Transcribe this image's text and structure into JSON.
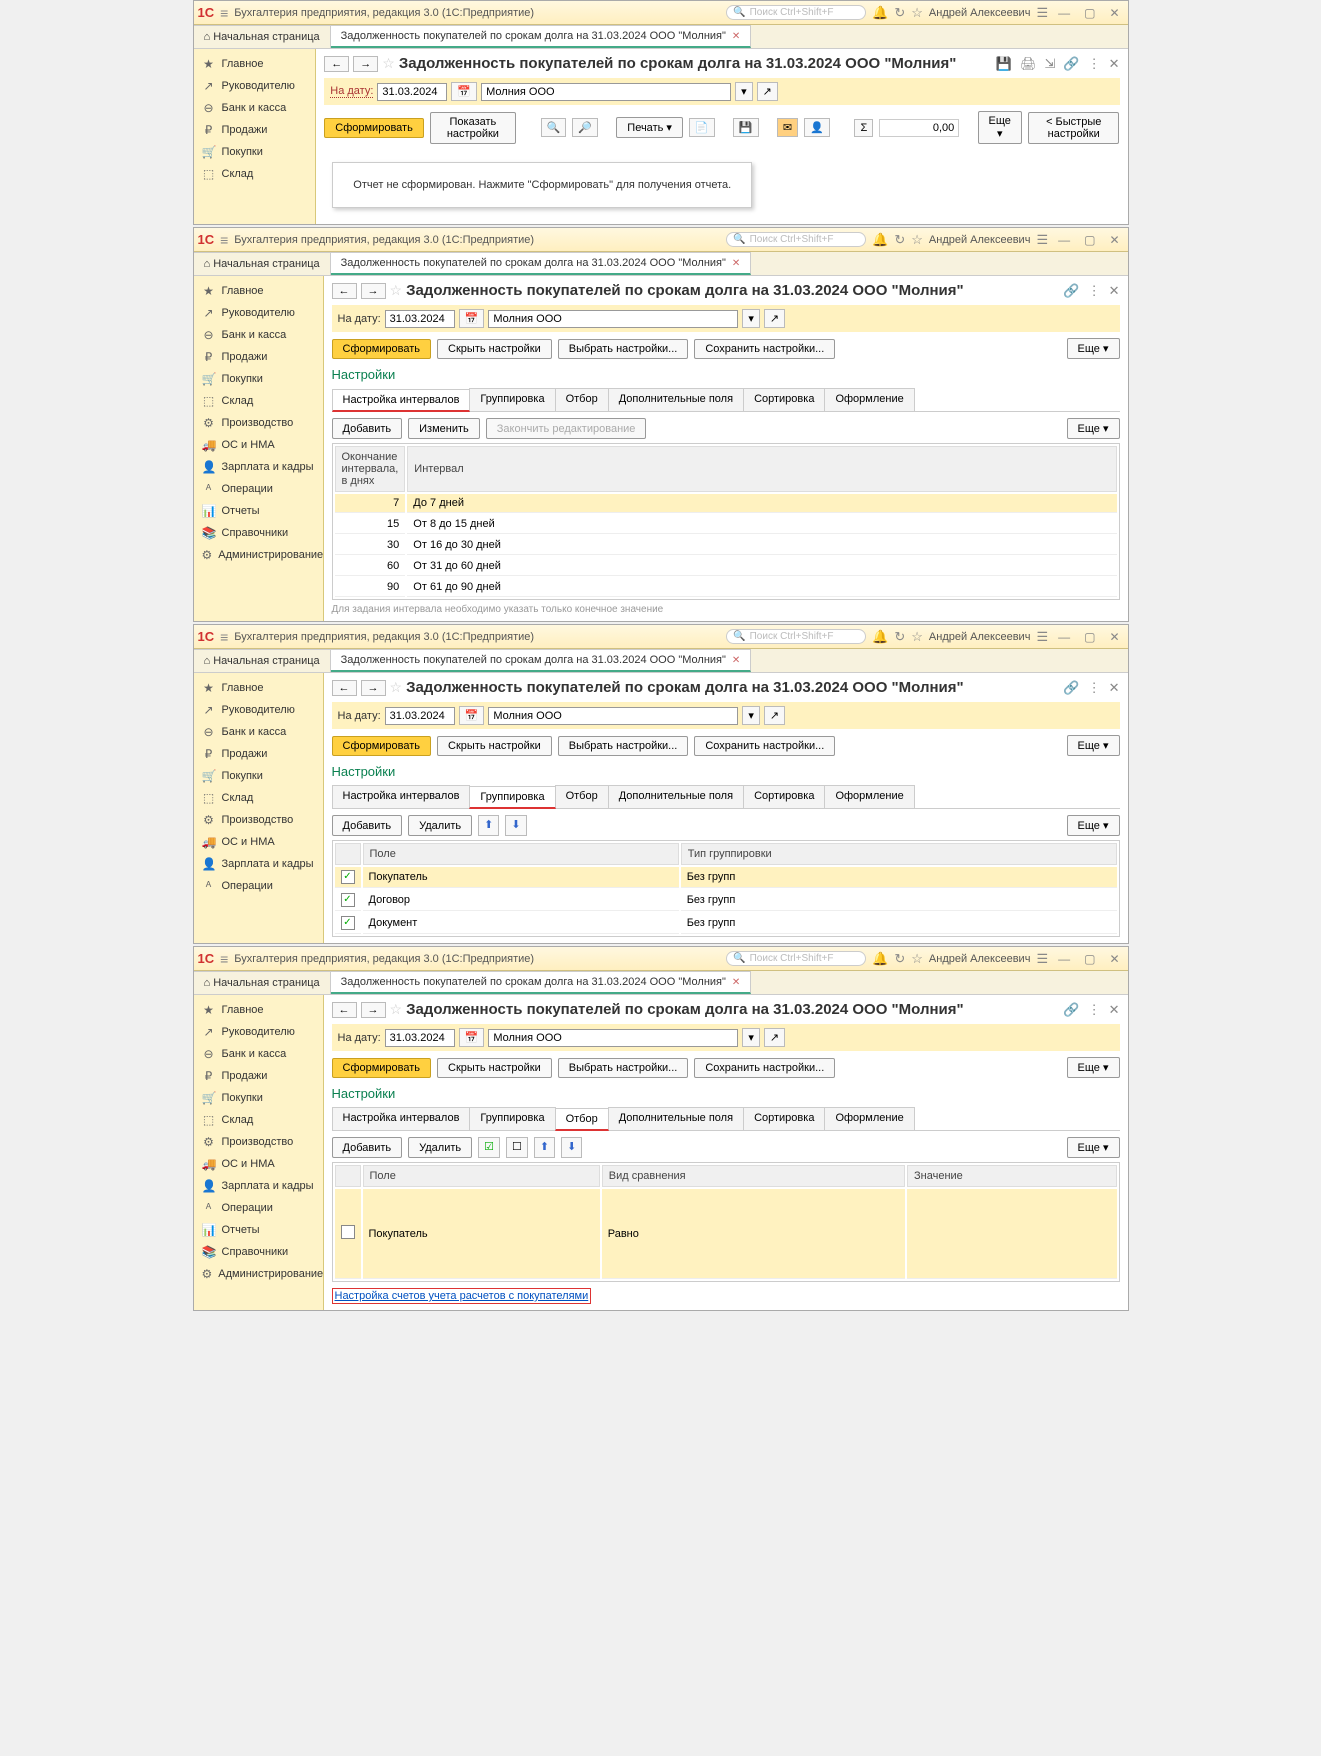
{
  "app_title": "Бухгалтерия предприятия, редакция 3.0  (1С:Предприятие)",
  "search_placeholder": "Поиск Ctrl+Shift+F",
  "user": "Андрей Алексеевич",
  "tab_home": "Начальная страница",
  "tab_report": "Задолженность покупателей по срокам долга на 31.03.2024 ООО \"Молния\"",
  "page_title": "Задолженность покупателей по срокам долга на 31.03.2024 ООО \"Молния\"",
  "date_label": "На дату:",
  "date_value": "31.03.2024",
  "org_value": "Молния ООО",
  "btn_form": "Сформировать",
  "btn_show_settings": "Показать настройки",
  "btn_hide_settings": "Скрыть настройки",
  "btn_choose_settings": "Выбрать настройки...",
  "btn_save_settings": "Сохранить настройки...",
  "btn_print": "Печать",
  "btn_more": "Еще",
  "btn_quick": "Быстрые настройки",
  "btn_add": "Добавить",
  "btn_edit": "Изменить",
  "btn_delete": "Удалить",
  "btn_finish": "Закончить редактирование",
  "sum_value": "0,00",
  "info_text": "Отчет не сформирован. Нажмите \"Сформировать\" для получения отчета.",
  "settings_title": "Настройки",
  "subtabs": [
    "Настройка интервалов",
    "Группировка",
    "Отбор",
    "Дополнительные поля",
    "Сортировка",
    "Оформление"
  ],
  "sidebar_full": [
    "Главное",
    "Руководителю",
    "Банк и касса",
    "Продажи",
    "Покупки",
    "Склад",
    "Производство",
    "ОС и НМА",
    "Зарплата и кадры",
    "Операции",
    "Отчеты",
    "Справочники",
    "Администрирование"
  ],
  "sidebar_short": [
    "Главное",
    "Руководителю",
    "Банк и касса",
    "Продажи",
    "Покупки",
    "Склад"
  ],
  "sidebar_icons": [
    "★",
    "↗",
    "⊖",
    "₽",
    "🛒",
    "⬚",
    "⚙",
    "🚚",
    "👤",
    "ᴬ",
    "📊",
    "📚",
    "⚙"
  ],
  "intervals": {
    "col1": "Окончание интервала, в днях",
    "col2": "Интервал",
    "rows": [
      {
        "n": "7",
        "t": "До 7 дней"
      },
      {
        "n": "15",
        "t": "От 8 до 15 дней"
      },
      {
        "n": "30",
        "t": "От 16 до 30 дней"
      },
      {
        "n": "60",
        "t": "От 31 до 60 дней"
      },
      {
        "n": "90",
        "t": "От 61 до 90 дней"
      }
    ],
    "hint": "Для задания интервала необходимо указать только конечное значение"
  },
  "grouping": {
    "col_field": "Поле",
    "col_type": "Тип группировки",
    "rows": [
      {
        "f": "Покупатель",
        "t": "Без групп"
      },
      {
        "f": "Договор",
        "t": "Без групп"
      },
      {
        "f": "Документ",
        "t": "Без групп"
      }
    ]
  },
  "filter": {
    "col_field": "Поле",
    "col_cmp": "Вид сравнения",
    "col_val": "Значение",
    "rows": [
      {
        "f": "Покупатель",
        "c": "Равно",
        "v": ""
      }
    ],
    "link": "Настройка счетов учета расчетов с покупателями"
  }
}
